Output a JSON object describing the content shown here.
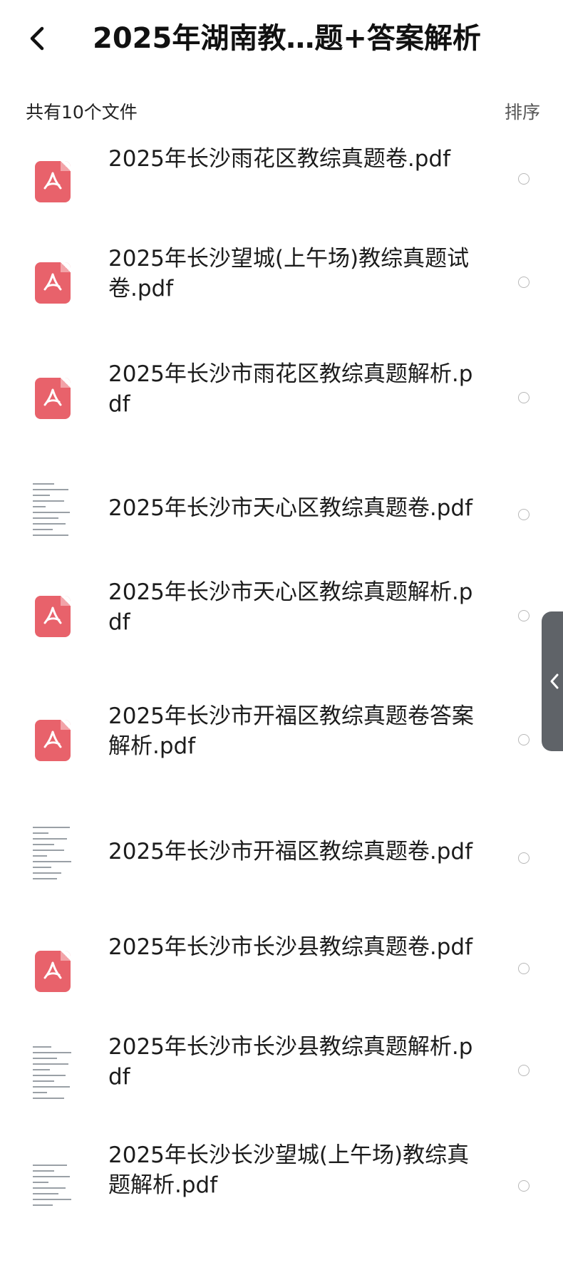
{
  "header": {
    "title": "2025年湖南教…题+答案解析"
  },
  "subbar": {
    "count_text": "共有10个文件",
    "sort_label": "排序"
  },
  "files": [
    {
      "name": "2025年长沙雨花区教综真题卷.pdf",
      "thumb": "pdf-icon"
    },
    {
      "name": "2025年长沙望城(上午场)教综真题试卷.pdf",
      "thumb": "pdf-icon"
    },
    {
      "name": "2025年长沙市雨花区教综真题解析.pdf",
      "thumb": "pdf-icon"
    },
    {
      "name": "2025年长沙市天心区教综真题卷.pdf",
      "thumb": "document-preview"
    },
    {
      "name": "2025年长沙市天心区教综真题解析.pdf",
      "thumb": "pdf-icon"
    },
    {
      "name": "2025年长沙市开福区教综真题卷答案解析.pdf",
      "thumb": "pdf-icon"
    },
    {
      "name": "2025年长沙市开福区教综真题卷.pdf",
      "thumb": "document-preview"
    },
    {
      "name": "2025年长沙市长沙县教综真题卷.pdf",
      "thumb": "pdf-icon"
    },
    {
      "name": "2025年长沙市长沙县教综真题解析.pdf",
      "thumb": "document-preview"
    },
    {
      "name": "2025年长沙长沙望城(上午场)教综真题解析.pdf",
      "thumb": "document-preview"
    }
  ],
  "colors": {
    "pdf_icon": "#e8626b",
    "side_handle": "#5f6368"
  }
}
